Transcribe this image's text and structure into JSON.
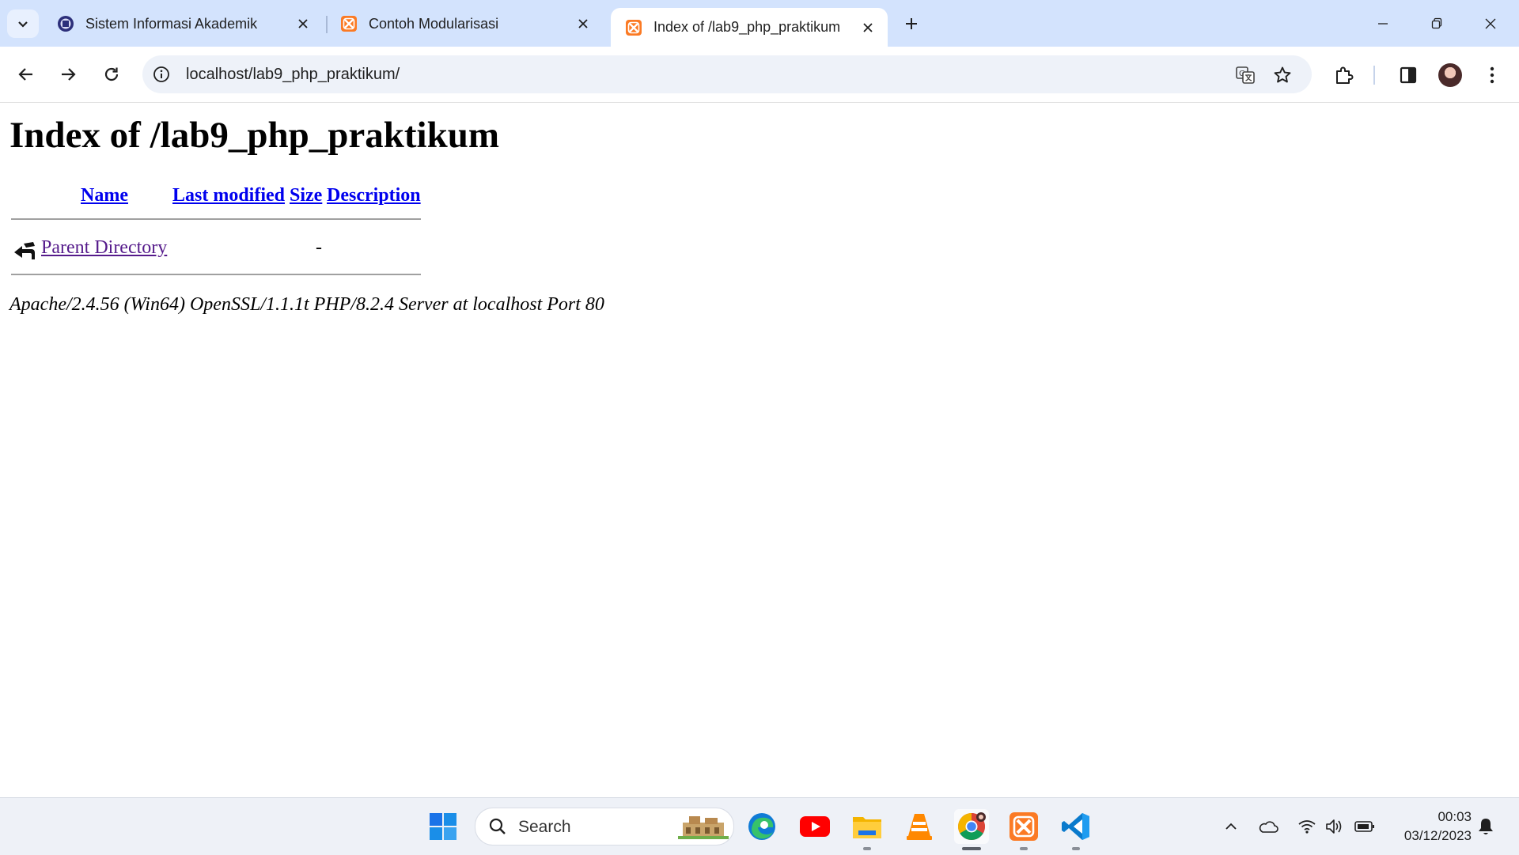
{
  "browser": {
    "tabs": [
      {
        "title": "Sistem Informasi Akademik",
        "favicon": "university-seal-icon",
        "active": false
      },
      {
        "title": "Contoh Modularisasi",
        "favicon": "xampp-icon",
        "active": false
      },
      {
        "title": "Index of /lab9_php_praktikum",
        "favicon": "xampp-icon",
        "active": true
      }
    ],
    "url": "localhost/lab9_php_praktikum/"
  },
  "page": {
    "title": "Index of /lab9_php_praktikum",
    "columns": {
      "name": "Name",
      "last_modified": "Last modified",
      "size": "Size",
      "description": "Description"
    },
    "rows": [
      {
        "name": "Parent Directory",
        "last_modified": "",
        "size": "-",
        "description": "",
        "icon": "back-arrow-icon"
      }
    ],
    "server_signature": "Apache/2.4.56 (Win64) OpenSSL/1.1.1t PHP/8.2.4 Server at localhost Port 80"
  },
  "taskbar": {
    "search_label": "Search",
    "apps": [
      "windows-start-icon",
      "edge-icon",
      "youtube-icon",
      "file-explorer-icon",
      "vlc-icon",
      "chrome-icon",
      "xampp-icon",
      "vscode-icon"
    ],
    "time": "00:03",
    "date": "03/12/2023"
  },
  "colors": {
    "tabstrip_bg": "#d3e3fd",
    "link": "#0000ee",
    "visited_link": "#551a8b",
    "xampp_orange": "#fb7a24"
  }
}
